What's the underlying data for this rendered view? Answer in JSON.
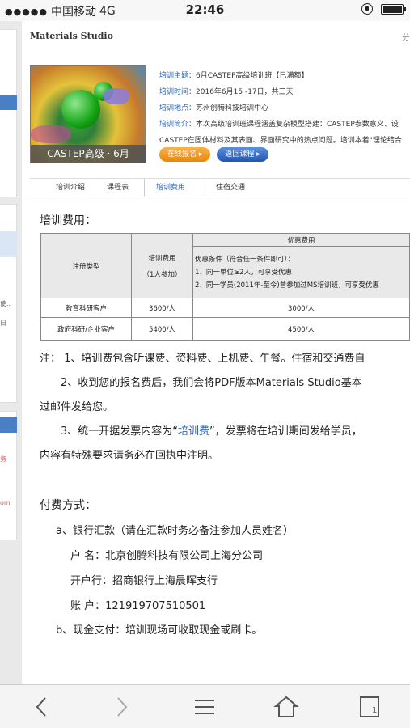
{
  "status_bar": {
    "signal": "●●●●●",
    "carrier": "中国移动",
    "network": "4G",
    "time": "22:46"
  },
  "site": {
    "header": "Materials Studio",
    "share": "分"
  },
  "course": {
    "image_caption": "CASTEP高级 · 6月",
    "fields": [
      {
        "label": "培训主题：",
        "value": "6月CASTEP高级培训班【已满额】"
      },
      {
        "label": "培训时间：",
        "value": "2016年6月15 -17日，共三天"
      },
      {
        "label": "培训地点：",
        "value": "苏州创腾科技培训中心"
      },
      {
        "label": "培训简介：",
        "value": "本次高级培训班课程涵盖复杂模型搭建：CASTEP参数意义、设"
      }
    ],
    "intro_line2": "CASTEP在固体材料及其表面、界面研究中的热点问题。培训本着\"理论结合",
    "apply_button": "在线报名 ▸",
    "back_button": "返回课程 ▸"
  },
  "tabs": [
    {
      "label": "培训介绍"
    },
    {
      "label": "课程表"
    },
    {
      "label": "培训费用"
    },
    {
      "label": "住宿交通"
    }
  ],
  "fees": {
    "title": "培训费用：",
    "table": {
      "col1_header": "注册类型",
      "col2_header_1": "培训费用",
      "col2_header_2": "（1人参加）",
      "pref_header": "优惠费用",
      "pref_conditions": "优惠条件（符合任一条件即可）：",
      "pref_1": "1、同一单位≥2人，可享受优惠",
      "pref_2": "2、同一学员(2011年-至今)曾参加过MS培训班，可享受优惠",
      "rows": [
        {
          "type": "教育科研客户",
          "price": "3600/人",
          "discount": "3000/人"
        },
        {
          "type": "政府科研/企业客户",
          "price": "5400/人",
          "discount": "4500/人"
        }
      ]
    },
    "note1": "注：  1、培训费包含听课费、资料费、上机费、午餐。住宿和交通费自",
    "note2": "2、收到您的报名费后，我们会将PDF版本Materials Studio基本",
    "note2b": "过邮件发给您。",
    "note3_pre": "3、统一开据发票内容为“",
    "note3_hl": "培训费",
    "note3_post": "”，发票将在培训期间发给学员，",
    "note3b": "内容有特殊要求请务必在回执中注明。"
  },
  "payment": {
    "title": "付费方式：",
    "bank_transfer": "a、银行汇款（请在汇款时务必备注参加人员姓名）",
    "account_name_label": "户    名：",
    "account_name": "北京创腾科技有限公司上海分公司",
    "bank_label": "开户行：",
    "bank": "招商银行上海晨晖支行",
    "account_no_label": "账    户：",
    "account_no": "121919707510501",
    "cash": "b、现金支付：培训现场可收取现金或刷卡。"
  },
  "side": {
    "text_a": "使..",
    "text_b": "日",
    "text_c": "务",
    "text_d": "om"
  },
  "colors": {
    "link_blue": "#2a62b5",
    "accent_orange": "#e8860c",
    "toolbar_bg": "#f4f4f4"
  },
  "toolbar": {
    "tab_count": "1"
  }
}
